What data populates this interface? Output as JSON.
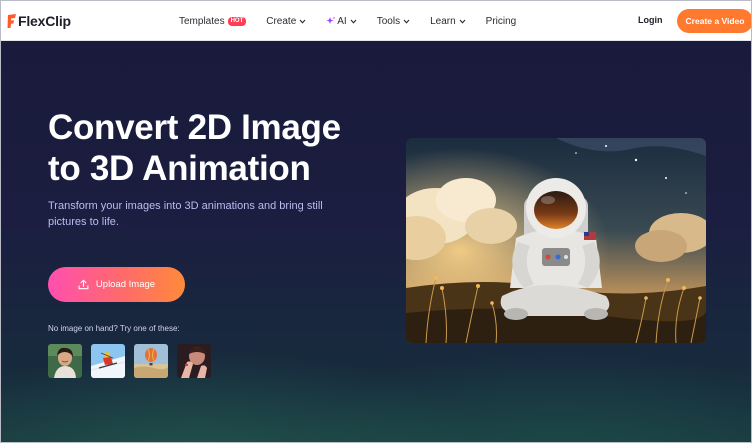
{
  "brand": {
    "logo_text": "FlexClip",
    "accent": "#ff7a2e"
  },
  "nav": {
    "items": [
      {
        "label": "Templates",
        "badge": "HOT",
        "has_dropdown": false
      },
      {
        "label": "Create",
        "has_dropdown": true
      },
      {
        "label": "AI",
        "has_dropdown": true,
        "icon": "sparkle-icon"
      },
      {
        "label": "Tools",
        "has_dropdown": true
      },
      {
        "label": "Learn",
        "has_dropdown": true
      },
      {
        "label": "Pricing",
        "has_dropdown": false
      }
    ],
    "login_label": "Login",
    "cta_label": "Create a Video"
  },
  "hero": {
    "title_line1": "Convert 2D Image",
    "title_line2": "to 3D Animation",
    "subtitle": "Transform your images into 3D animations and bring still pictures to life.",
    "upload_label": "Upload Image",
    "try_label": "No image on hand? Try one of these:",
    "samples": [
      "woman-portrait",
      "skier",
      "hot-air-balloon",
      "hands-portrait"
    ],
    "preview_image": "astronaut-in-meadow"
  }
}
